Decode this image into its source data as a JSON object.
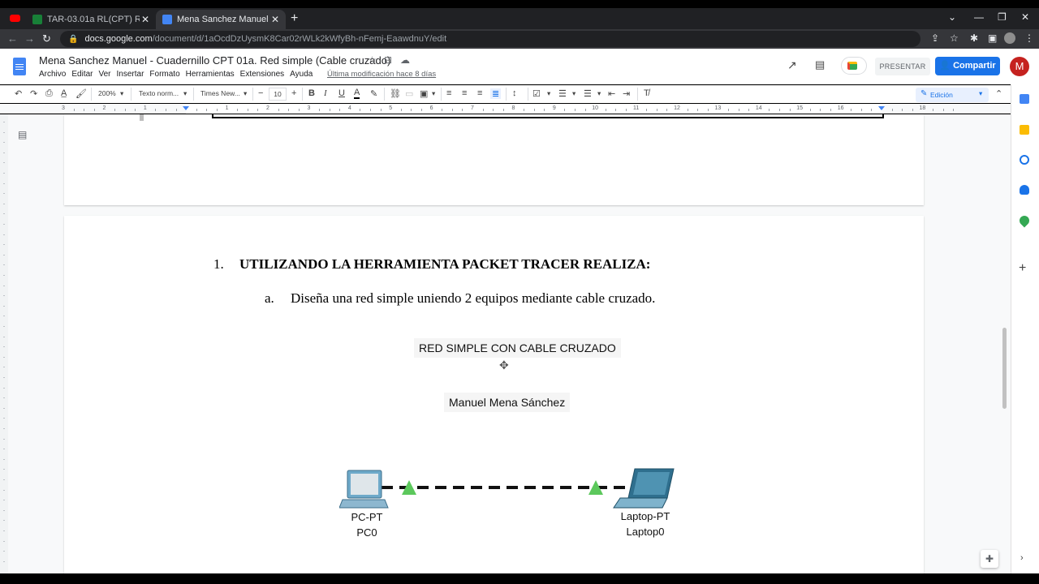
{
  "browser": {
    "tabs": [
      {
        "title": "TAR-03.01a RL(CPT) Red Simple..",
        "active": false
      },
      {
        "title": "Mena Sanchez Manuel - Cuadern",
        "active": true
      }
    ],
    "url_domain": "docs.google.com",
    "url_path": "/document/d/1aOcdDzUysmK8Car02rWLk2kWfyBh-nFemj-EaawdnuY/edit"
  },
  "docs": {
    "title": "Mena Sanchez Manuel - Cuadernillo CPT 01a. Red simple (Cable cruzado)",
    "menu": [
      "Archivo",
      "Editar",
      "Ver",
      "Insertar",
      "Formato",
      "Herramientas",
      "Extensiones",
      "Ayuda"
    ],
    "last_edit": "Última modificación hace 8 días",
    "present_label": "PRESENTAR",
    "share_label": "Compartir",
    "avatar_letter": "M",
    "accent_color": "#1a73e8"
  },
  "toolbar": {
    "zoom": "200%",
    "style": "Texto norm...",
    "font": "Times New...",
    "font_size": "10",
    "mode": "Edición"
  },
  "ruler": {
    "labels": [
      "3",
      "2",
      "1",
      "",
      "1",
      "2",
      "3",
      "4",
      "5",
      "6",
      "7",
      "8",
      "9",
      "10",
      "11",
      "12",
      "13",
      "14",
      "15",
      "16",
      "",
      "18"
    ]
  },
  "content": {
    "list_number": "1.",
    "heading": "UTILIZANDO LA HERRAMIENTA PACKET TRACER REALIZA:",
    "sub_letter": "a.",
    "sub_text": "Diseña una red simple uniendo 2 equipos mediante cable cruzado.",
    "diagram": {
      "title_note": "RED SIMPLE CON CABLE CRUZADO",
      "author_note": "Manuel Mena Sánchez",
      "pc": {
        "type": "PC-PT",
        "name": "PC0"
      },
      "laptop": {
        "type": "Laptop-PT",
        "name": "Laptop0"
      },
      "link_status_color": "#5cc85c"
    }
  }
}
